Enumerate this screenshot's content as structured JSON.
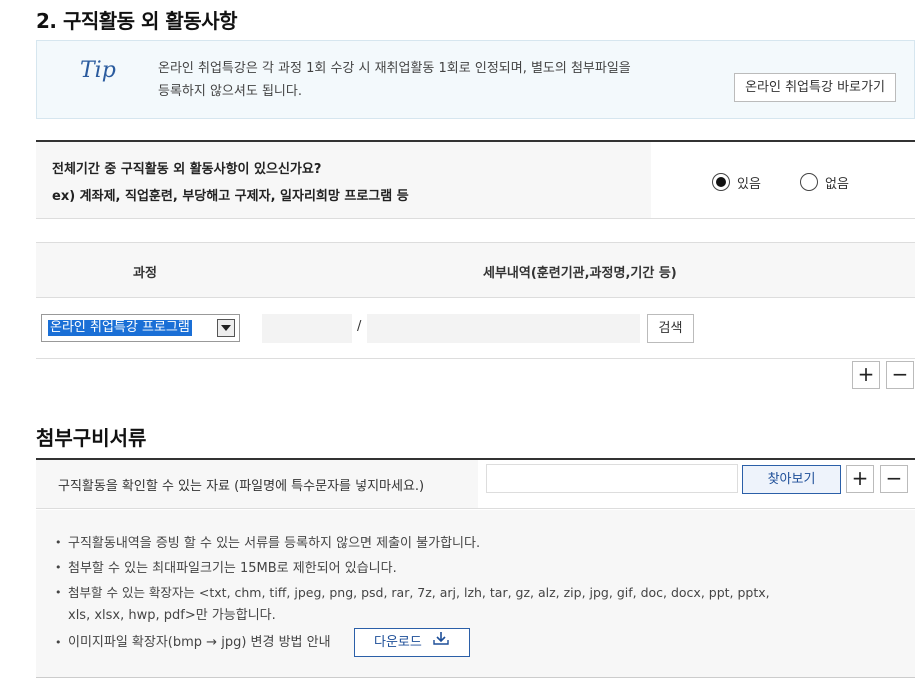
{
  "section1": {
    "title": "2. 구직활동 외 활동사항",
    "tip": {
      "logo": "Tip",
      "line1": "온라인 취업특강은 각 과정 1회 수강 시 재취업활동 1회로 인정되며, 별도의 첨부파일을",
      "line2": "등록하지 않으셔도 됩니다.",
      "button": "온라인 취업특강 바로가기"
    },
    "question": {
      "line1": "전체기간 중 구직활동 외 활동사항이 있으신가요?",
      "line2": "ex) 계좌제, 직업훈련, 부당해고 구제자, 일자리희망 프로그램 등",
      "options": [
        {
          "label": "있음",
          "selected": true
        },
        {
          "label": "없음",
          "selected": false
        }
      ]
    },
    "table": {
      "headers": [
        "과정",
        "세부내역(훈련기관,과정명,기간 등)"
      ],
      "row": {
        "course_selected": "온라인 취업특강 프로그램",
        "slash": "/",
        "search_button": "검색"
      }
    },
    "add_label": "+",
    "remove_label": "−"
  },
  "section2": {
    "title": "첨부구비서류",
    "attach_label": "구직활동을 확인할 수 있는 자료 (파일명에 특수문자를 넣지마세요.)",
    "browse_button": "찾아보기",
    "add_label": "+",
    "remove_label": "−",
    "notes": [
      "구직활동내역을 증빙 할 수 있는 서류를 등록하지 않으면 제출이 불가합니다.",
      "첨부할 수 있는 최대파일크기는 15MB로 제한되어 있습니다.",
      "첨부할 수 있는 확장자는 <txt, chm, tiff, jpeg, png, psd, rar, 7z, arj, lzh, tar, gz, alz, zip, jpg, gif, doc, docx, ppt, pptx,",
      "xls, xlsx, hwp, pdf>만 가능합니다.",
      "이미지파일 확장자(bmp → jpg) 변경 방법 안내"
    ],
    "download_button": "다운로드"
  }
}
